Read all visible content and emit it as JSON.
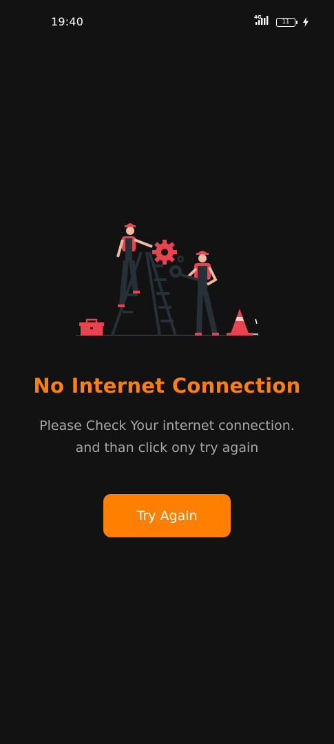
{
  "status_bar": {
    "time": "19:40",
    "network": "4G",
    "battery_level": "11",
    "icons": [
      "signal-icon",
      "battery-icon",
      "charging-bolt-icon"
    ]
  },
  "illustration": {
    "icon": "maintenance-workers-illustration",
    "colors": {
      "accent": "#e8434f",
      "dark": "#253038",
      "skin": "#f2b8a0"
    }
  },
  "error": {
    "title": "No Internet Connection",
    "message_lines": [
      "Please Check Your internet connection.",
      "and than click ony try again"
    ]
  },
  "actions": {
    "retry_label": "Try Again"
  },
  "colors": {
    "background": "#121212",
    "title": "#ff7f0a",
    "message": "#a8a8a8",
    "button": "#ff8000",
    "button_text": "#ffffff"
  }
}
